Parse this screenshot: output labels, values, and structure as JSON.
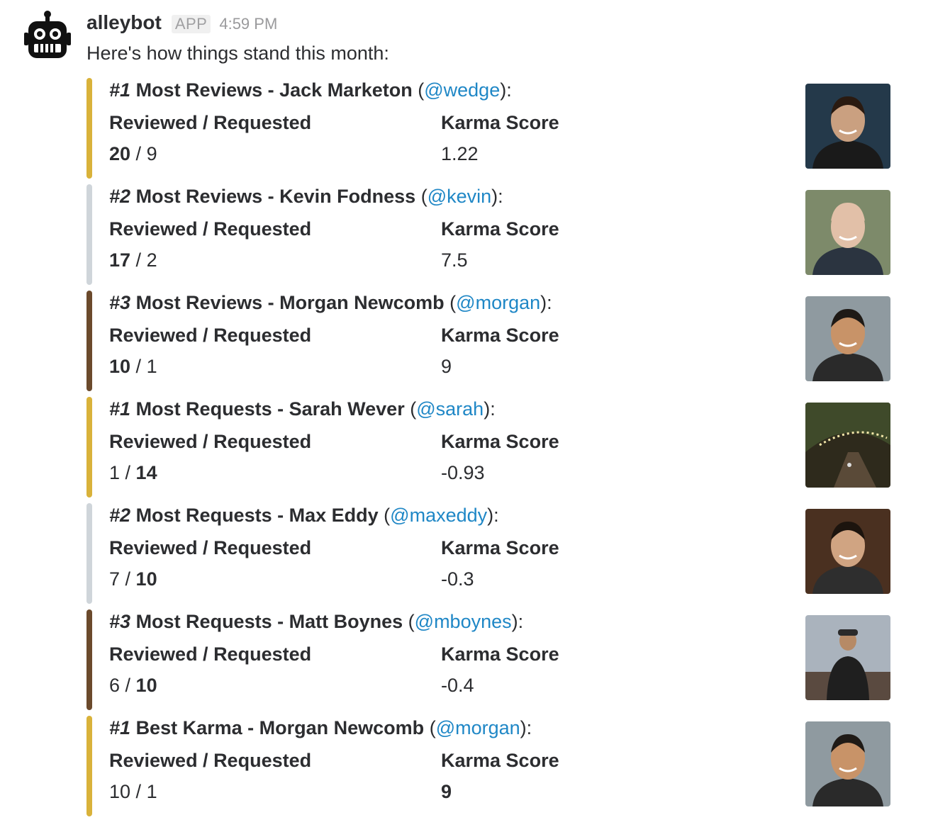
{
  "bot": {
    "name": "alleybot",
    "badge": "APP",
    "time": "4:59 PM",
    "avatar_icon": "robot-icon"
  },
  "message": {
    "text": "Here's how things stand this month:"
  },
  "attachments": [
    {
      "color": "#d9b23a",
      "rank": "#1",
      "category": "Most Reviews",
      "name": "Jack Marketon",
      "handle": "@wedge",
      "label_reviewed": "Reviewed / Requested",
      "label_karma": "Karma Score",
      "reviewed": "20",
      "requested": "9",
      "karma": "1.22",
      "bold": "reviewed"
    },
    {
      "color": "#cfd5da",
      "rank": "#2",
      "category": "Most Reviews",
      "name": "Kevin Fodness",
      "handle": "@kevin",
      "label_reviewed": "Reviewed / Requested",
      "label_karma": "Karma Score",
      "reviewed": "17",
      "requested": "2",
      "karma": "7.5",
      "bold": "reviewed"
    },
    {
      "color": "#6b4a2c",
      "rank": "#3",
      "category": "Most Reviews",
      "name": "Morgan Newcomb",
      "handle": "@morgan",
      "label_reviewed": "Reviewed / Requested",
      "label_karma": "Karma Score",
      "reviewed": "10",
      "requested": "1",
      "karma": "9",
      "bold": "reviewed"
    },
    {
      "color": "#d9b23a",
      "rank": "#1",
      "category": "Most Requests",
      "name": "Sarah Wever",
      "handle": "@sarah",
      "label_reviewed": "Reviewed / Requested",
      "label_karma": "Karma Score",
      "reviewed": "1",
      "requested": "14",
      "karma": "-0.93",
      "bold": "requested"
    },
    {
      "color": "#cfd5da",
      "rank": "#2",
      "category": "Most Requests",
      "name": "Max Eddy",
      "handle": "@maxeddy",
      "label_reviewed": "Reviewed / Requested",
      "label_karma": "Karma Score",
      "reviewed": "7",
      "requested": "10",
      "karma": "-0.3",
      "bold": "requested"
    },
    {
      "color": "#6b4a2c",
      "rank": "#3",
      "category": "Most Requests",
      "name": "Matt Boynes",
      "handle": "@mboynes",
      "label_reviewed": "Reviewed / Requested",
      "label_karma": "Karma Score",
      "reviewed": "6",
      "requested": "10",
      "karma": "-0.4",
      "bold": "requested"
    },
    {
      "color": "#d9b23a",
      "rank": "#1",
      "category": "Best Karma",
      "name": "Morgan Newcomb",
      "handle": "@morgan",
      "label_reviewed": "Reviewed / Requested",
      "label_karma": "Karma Score",
      "reviewed": "10",
      "requested": "1",
      "karma": "9",
      "bold": "karma"
    }
  ]
}
